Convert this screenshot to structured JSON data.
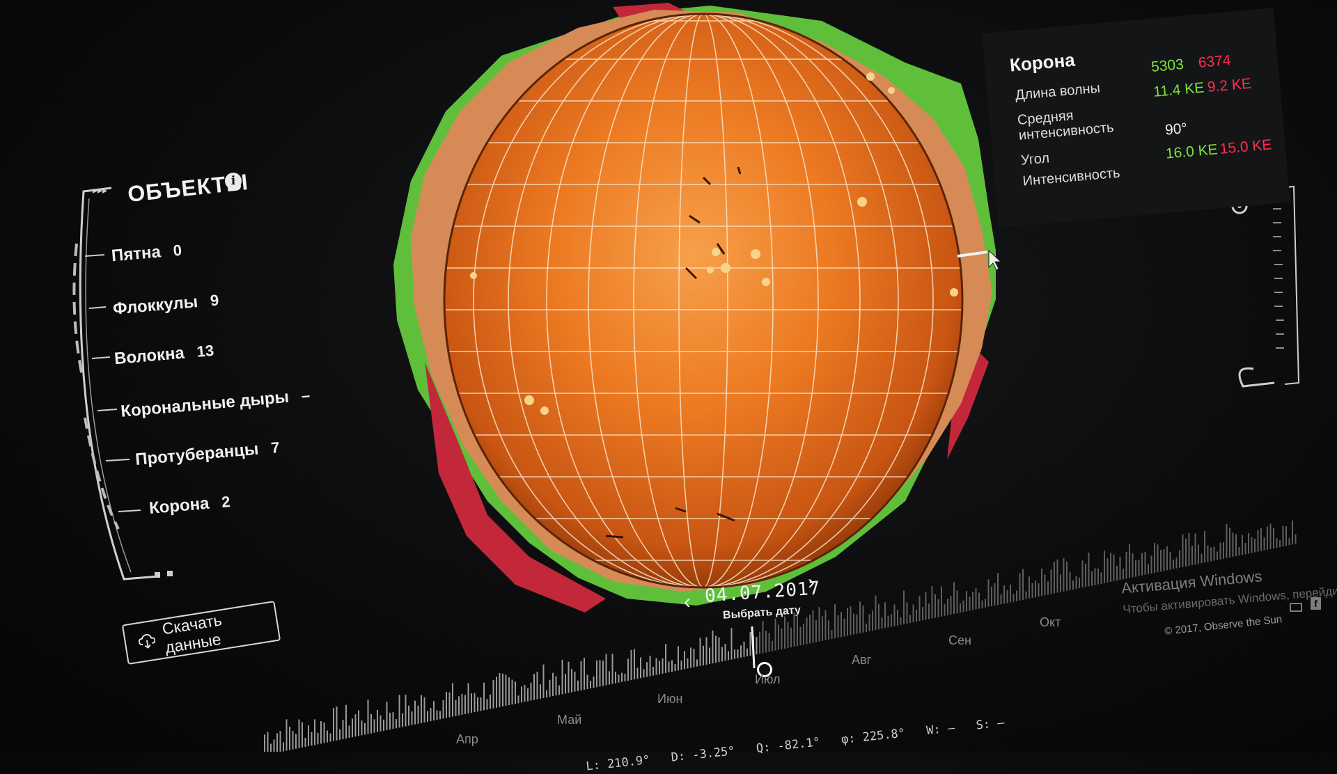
{
  "objects": {
    "title": "ОБЪЕКТЫ",
    "items": [
      {
        "label": "Пятна",
        "count": "0"
      },
      {
        "label": "Флоккулы",
        "count": "9"
      },
      {
        "label": "Волокна",
        "count": "13"
      },
      {
        "label": "Корональные дыры",
        "count": "–"
      },
      {
        "label": "Протуберанцы",
        "count": "7"
      },
      {
        "label": "Корона",
        "count": "2"
      }
    ],
    "download_label": "Скачать данные"
  },
  "corona_card": {
    "title": "Корона",
    "wavelength_label": "Длина волны",
    "avg_intensity_label": "Средняя интенсивность",
    "angle_label": "Угол",
    "intensity_label": "Интенсивность",
    "wavelength_green": "5303",
    "wavelength_red": "6374",
    "avg_intensity_green": "11.4 KE",
    "avg_intensity_red": "9.2 KE",
    "angle_value": "90°",
    "intensity_green": "16.0 KE",
    "intensity_red": "15.0 KE"
  },
  "date": {
    "current": "04.07.2017",
    "pick_label": "Выбрать дату"
  },
  "timeline": {
    "months": [
      "Апр",
      "Май",
      "Июн",
      "Июл",
      "Авг",
      "Сен",
      "Окт"
    ],
    "readout": {
      "l": "210.9°",
      "d": "-3.25°",
      "q": "-82.1°",
      "phi": "225.8°",
      "w": "–",
      "s": "–"
    }
  },
  "footer": {
    "copyright": "© 2017, Observe the Sun",
    "activation_title": "Активация Windows",
    "activation_sub": "Чтобы активировать Windows, перейдите"
  },
  "colors": {
    "sun_core": "#f08a2c",
    "sun_edge": "#b84a0f",
    "corona_green": "#5fbf3a",
    "corona_red": "#c3283a",
    "corona_tan": "#d68b57",
    "value_green": "#7be33a",
    "value_red": "#ff2f4f"
  },
  "icons": [
    "info-icon",
    "cloud-download-icon",
    "chevron-left-icon",
    "chevron-right-icon",
    "mouse-cursor-icon",
    "mail-icon",
    "facebook-icon"
  ]
}
